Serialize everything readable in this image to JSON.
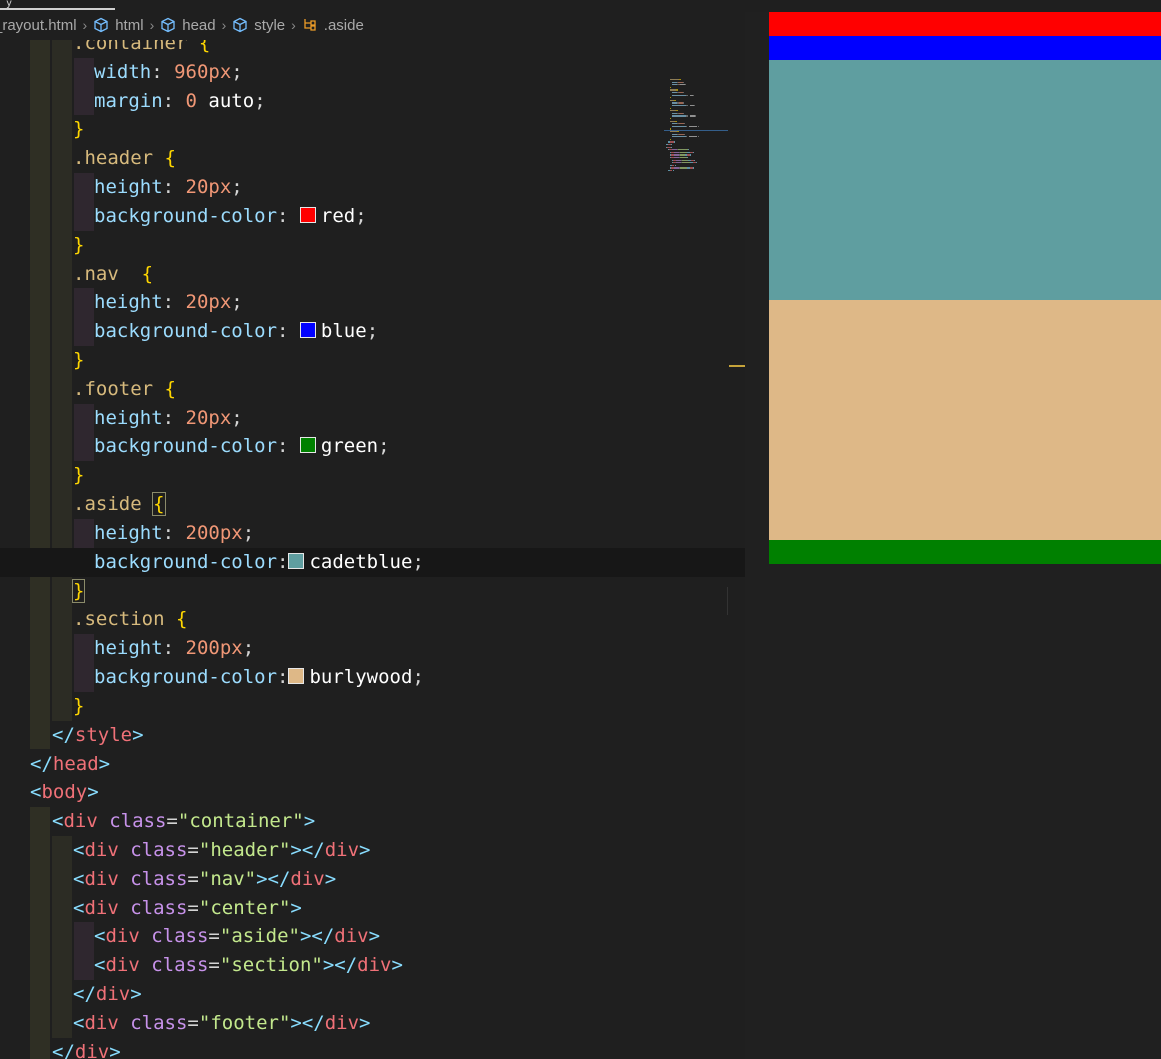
{
  "breadcrumb": {
    "file": "_rayout.html",
    "items": [
      "html",
      "head",
      "style",
      ".aside"
    ]
  },
  "code": [
    {
      "indent": 3,
      "tokens": [
        [
          "sel",
          ".container"
        ],
        [
          "brace",
          " {"
        ]
      ]
    },
    {
      "indent": 4,
      "tokens": [
        [
          "prop",
          "width"
        ],
        [
          "punc",
          ": "
        ],
        [
          "num",
          "960px"
        ],
        [
          "punc",
          ";"
        ]
      ]
    },
    {
      "indent": 4,
      "tokens": [
        [
          "prop",
          "margin"
        ],
        [
          "punc",
          ": "
        ],
        [
          "num",
          "0"
        ],
        [
          "val",
          " auto"
        ],
        [
          "punc",
          ";"
        ]
      ]
    },
    {
      "indent": 3,
      "tokens": [
        [
          "brace",
          "}"
        ]
      ]
    },
    {
      "indent": 3,
      "tokens": [
        [
          "sel",
          ".header"
        ],
        [
          "brace",
          " {"
        ]
      ]
    },
    {
      "indent": 4,
      "tokens": [
        [
          "prop",
          "height"
        ],
        [
          "punc",
          ": "
        ],
        [
          "num",
          "20px"
        ],
        [
          "punc",
          ";"
        ]
      ]
    },
    {
      "indent": 4,
      "tokens": [
        [
          "prop",
          "background-color"
        ],
        [
          "punc",
          ": "
        ],
        [
          "swatch",
          "#ff0000"
        ],
        [
          "val",
          "red"
        ],
        [
          "punc",
          ";"
        ]
      ]
    },
    {
      "indent": 3,
      "tokens": [
        [
          "brace",
          "}"
        ]
      ]
    },
    {
      "indent": 3,
      "tokens": [
        [
          "sel",
          ".nav"
        ],
        [
          "brace",
          "  {"
        ]
      ]
    },
    {
      "indent": 4,
      "tokens": [
        [
          "prop",
          "height"
        ],
        [
          "punc",
          ": "
        ],
        [
          "num",
          "20px"
        ],
        [
          "punc",
          ";"
        ]
      ]
    },
    {
      "indent": 4,
      "tokens": [
        [
          "prop",
          "background-color"
        ],
        [
          "punc",
          ": "
        ],
        [
          "swatch",
          "#0000ff"
        ],
        [
          "val",
          "blue"
        ],
        [
          "punc",
          ";"
        ]
      ]
    },
    {
      "indent": 3,
      "tokens": [
        [
          "brace",
          "}"
        ]
      ]
    },
    {
      "indent": 3,
      "tokens": [
        [
          "sel",
          ".footer"
        ],
        [
          "brace",
          " {"
        ]
      ]
    },
    {
      "indent": 4,
      "tokens": [
        [
          "prop",
          "height"
        ],
        [
          "punc",
          ": "
        ],
        [
          "num",
          "20px"
        ],
        [
          "punc",
          ";"
        ]
      ]
    },
    {
      "indent": 4,
      "tokens": [
        [
          "prop",
          "background-color"
        ],
        [
          "punc",
          ": "
        ],
        [
          "swatch",
          "#008000"
        ],
        [
          "val",
          "green"
        ],
        [
          "punc",
          ";"
        ]
      ]
    },
    {
      "indent": 3,
      "tokens": [
        [
          "brace",
          "}"
        ]
      ]
    },
    {
      "indent": 3,
      "tokens": [
        [
          "sel",
          ".aside"
        ],
        [
          "brace",
          " "
        ],
        [
          "bracebox",
          "{"
        ]
      ]
    },
    {
      "indent": 4,
      "tokens": [
        [
          "prop",
          "height"
        ],
        [
          "punc",
          ": "
        ],
        [
          "num",
          "200px"
        ],
        [
          "punc",
          ";"
        ]
      ]
    },
    {
      "indent": 4,
      "current": true,
      "tokens": [
        [
          "prop",
          "background-color"
        ],
        [
          "punc",
          ":"
        ],
        [
          "swatch",
          "#5f9ea0"
        ],
        [
          "val",
          "cadetblue"
        ],
        [
          "punc",
          ";"
        ]
      ]
    },
    {
      "indent": 3,
      "tokens": [
        [
          "bracebox",
          "}"
        ]
      ]
    },
    {
      "indent": 3,
      "tokens": [
        [
          "sel",
          ".section"
        ],
        [
          "brace",
          " {"
        ]
      ]
    },
    {
      "indent": 4,
      "tokens": [
        [
          "prop",
          "height"
        ],
        [
          "punc",
          ": "
        ],
        [
          "num",
          "200px"
        ],
        [
          "punc",
          ";"
        ]
      ]
    },
    {
      "indent": 4,
      "tokens": [
        [
          "prop",
          "background-color"
        ],
        [
          "punc",
          ":"
        ],
        [
          "swatch",
          "#deb887"
        ],
        [
          "val",
          "burlywood"
        ],
        [
          "punc",
          ";"
        ]
      ]
    },
    {
      "indent": 3,
      "tokens": [
        [
          "brace",
          "}"
        ]
      ]
    },
    {
      "indent": 2,
      "tokens": [
        [
          "angle",
          "</"
        ],
        [
          "tag",
          "style"
        ],
        [
          "angle",
          ">"
        ]
      ]
    },
    {
      "indent": 1,
      "tokens": [
        [
          "angle",
          "</"
        ],
        [
          "tag",
          "head"
        ],
        [
          "angle",
          ">"
        ]
      ]
    },
    {
      "indent": 1,
      "tokens": [
        [
          "angle",
          "<"
        ],
        [
          "tag",
          "body"
        ],
        [
          "angle",
          ">"
        ]
      ]
    },
    {
      "indent": 2,
      "tokens": [
        [
          "angle",
          "<"
        ],
        [
          "tag",
          "div"
        ],
        [
          "attr",
          " class"
        ],
        [
          "punc",
          "="
        ],
        [
          "str",
          "\"container\""
        ],
        [
          "angle",
          ">"
        ]
      ]
    },
    {
      "indent": 3,
      "tokens": [
        [
          "angle",
          "<"
        ],
        [
          "tag",
          "div"
        ],
        [
          "attr",
          " class"
        ],
        [
          "punc",
          "="
        ],
        [
          "str",
          "\"header\""
        ],
        [
          "angle",
          "></"
        ],
        [
          "tag",
          "div"
        ],
        [
          "angle",
          ">"
        ]
      ]
    },
    {
      "indent": 3,
      "tokens": [
        [
          "angle",
          "<"
        ],
        [
          "tag",
          "div"
        ],
        [
          "attr",
          " class"
        ],
        [
          "punc",
          "="
        ],
        [
          "str",
          "\"nav\""
        ],
        [
          "angle",
          "></"
        ],
        [
          "tag",
          "div"
        ],
        [
          "angle",
          ">"
        ]
      ]
    },
    {
      "indent": 3,
      "tokens": [
        [
          "angle",
          "<"
        ],
        [
          "tag",
          "div"
        ],
        [
          "attr",
          " class"
        ],
        [
          "punc",
          "="
        ],
        [
          "str",
          "\"center\""
        ],
        [
          "angle",
          ">"
        ]
      ]
    },
    {
      "indent": 4,
      "tokens": [
        [
          "angle",
          "<"
        ],
        [
          "tag",
          "div"
        ],
        [
          "attr",
          " class"
        ],
        [
          "punc",
          "="
        ],
        [
          "str",
          "\"aside\""
        ],
        [
          "angle",
          "></"
        ],
        [
          "tag",
          "div"
        ],
        [
          "angle",
          ">"
        ]
      ]
    },
    {
      "indent": 4,
      "tokens": [
        [
          "angle",
          "<"
        ],
        [
          "tag",
          "div"
        ],
        [
          "attr",
          " class"
        ],
        [
          "punc",
          "="
        ],
        [
          "str",
          "\"section\""
        ],
        [
          "angle",
          "></"
        ],
        [
          "tag",
          "div"
        ],
        [
          "angle",
          ">"
        ]
      ]
    },
    {
      "indent": 3,
      "tokens": [
        [
          "angle",
          "</"
        ],
        [
          "tag",
          "div"
        ],
        [
          "angle",
          ">"
        ]
      ]
    },
    {
      "indent": 3,
      "tokens": [
        [
          "angle",
          "<"
        ],
        [
          "tag",
          "div"
        ],
        [
          "attr",
          " class"
        ],
        [
          "punc",
          "="
        ],
        [
          "str",
          "\"footer\""
        ],
        [
          "angle",
          "></"
        ],
        [
          "tag",
          "div"
        ],
        [
          "angle",
          ">"
        ]
      ]
    },
    {
      "indent": 2,
      "tokens": [
        [
          "angle",
          "</"
        ],
        [
          "tag",
          "div"
        ],
        [
          "angle",
          ">"
        ]
      ]
    }
  ],
  "preview": {
    "blocks": [
      {
        "name": "preview-header",
        "color": "#ff0000",
        "height": 20
      },
      {
        "name": "preview-nav",
        "color": "#0000ff",
        "height": 20
      },
      {
        "name": "preview-aside",
        "color": "#5f9ea0",
        "height": 200
      },
      {
        "name": "preview-section",
        "color": "#deb887",
        "height": 200
      },
      {
        "name": "preview-footer",
        "color": "#008000",
        "height": 20
      }
    ]
  }
}
